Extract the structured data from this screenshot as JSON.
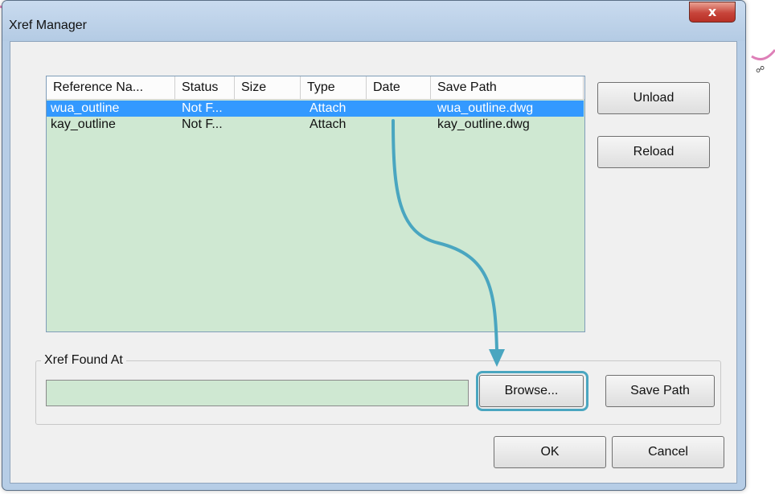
{
  "window": {
    "title": "Xref Manager",
    "close_label": "x"
  },
  "list": {
    "columns": [
      "Reference Na...",
      "Status",
      "Size",
      "Type",
      "Date",
      "Save Path"
    ],
    "rows": [
      {
        "name": "wua_outline",
        "status": "Not F...",
        "size": "",
        "type": "Attach",
        "date": "",
        "save_path": "wua_outline.dwg",
        "selected": true
      },
      {
        "name": "kay_outline",
        "status": "Not F...",
        "size": "",
        "type": "Attach",
        "date": "",
        "save_path": "kay_outline.dwg",
        "selected": false
      }
    ]
  },
  "side_buttons": {
    "unload": "Unload",
    "reload": "Reload"
  },
  "found_group": {
    "label": "Xref Found At",
    "value": "",
    "browse": "Browse...",
    "save_path": "Save Path"
  },
  "footer": {
    "ok": "OK",
    "cancel": "Cancel"
  },
  "colors": {
    "list_bg": "#cfe8d2",
    "selection": "#3399ff",
    "annotation": "#4aa6c0",
    "close_button": "#c7443a"
  },
  "annotation": {
    "icon": "curved-arrow-icon"
  }
}
